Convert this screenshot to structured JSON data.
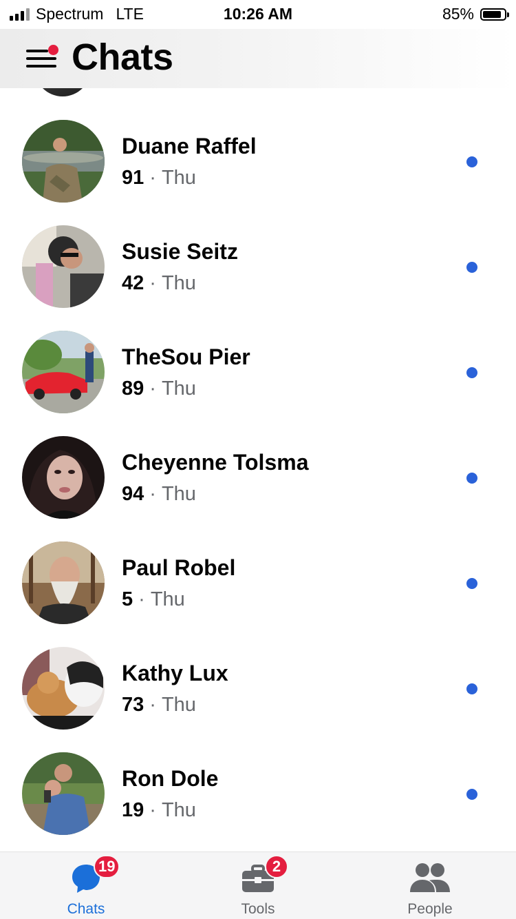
{
  "status_bar": {
    "carrier": "Spectrum",
    "network": "LTE",
    "time": "10:26 AM",
    "battery": "85%",
    "battery_level": 0.85
  },
  "header": {
    "title": "Chats",
    "menu_icon": "menu-icon",
    "notification_dot_color": "#e41e3f"
  },
  "chats": [
    {
      "name": "Duane Raffel",
      "count": "91",
      "day": "Thu",
      "unread": true
    },
    {
      "name": "Susie Seitz",
      "count": "42",
      "day": "Thu",
      "unread": true
    },
    {
      "name": "TheSou Pier",
      "count": "89",
      "day": "Thu",
      "unread": true
    },
    {
      "name": "Cheyenne Tolsma",
      "count": "94",
      "day": "Thu",
      "unread": true
    },
    {
      "name": "Paul Robel",
      "count": "5",
      "day": "Thu",
      "unread": true
    },
    {
      "name": "Kathy Lux",
      "count": "73",
      "day": "Thu",
      "unread": true
    },
    {
      "name": "Ron Dole",
      "count": "19",
      "day": "Thu",
      "unread": true
    }
  ],
  "separator": "·",
  "tabs": [
    {
      "label": "Chats",
      "badge": "19",
      "icon": "chat-bubble-icon",
      "active": true
    },
    {
      "label": "Tools",
      "badge": "2",
      "icon": "toolbox-icon",
      "active": false
    },
    {
      "label": "People",
      "badge": "",
      "icon": "people-icon",
      "active": false
    }
  ],
  "colors": {
    "accent": "#1b6fd9",
    "unread_dot": "#2a62d9",
    "badge": "#e41e3f",
    "secondary_text": "#65676b"
  }
}
